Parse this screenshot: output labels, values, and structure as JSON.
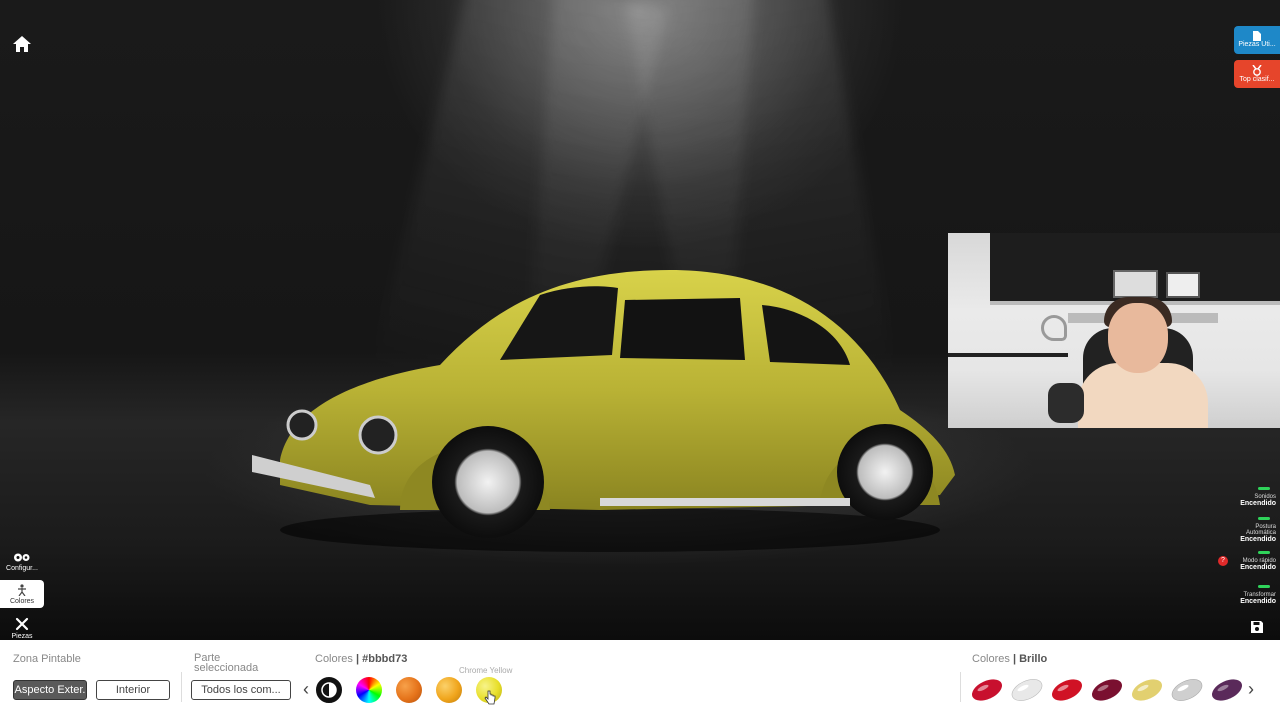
{
  "topright": {
    "parts_label": "Piezas Uti...",
    "parts_color": "#1e88c8",
    "ranking_label": "Top clasif...",
    "ranking_color": "#e6452b"
  },
  "sidebar": {
    "items": [
      {
        "label": "Configur...",
        "icon": "gears-icon"
      },
      {
        "label": "Colores",
        "icon": "paint-figure-icon"
      },
      {
        "label": "Piezas",
        "icon": "tools-icon"
      }
    ]
  },
  "toggles": [
    {
      "label": "Sonidos",
      "value": "Encendido"
    },
    {
      "label": "Postura Automática",
      "value": "Encendido"
    },
    {
      "label": "Modo rápido",
      "value": "Encendido"
    },
    {
      "label": "Transformar",
      "value": "Encendido"
    }
  ],
  "help_badge": "?",
  "bottom": {
    "zone_label": "Zona Pintable",
    "zone_options": [
      "Aspecto Exter.",
      "Interior"
    ],
    "part_label": "Parte seleccionada",
    "part_value": "Todos los com...",
    "colors_label": "Colores",
    "colors_hex": "#bbbd73",
    "hover_tooltip": "Chrome Yellow",
    "swatches": [
      {
        "name": "contrast",
        "color": "#111111"
      },
      {
        "name": "color-wheel",
        "color": "rainbow"
      },
      {
        "name": "orange",
        "color": "#e5731a"
      },
      {
        "name": "amber",
        "color": "#f0a51c"
      },
      {
        "name": "chrome-yellow",
        "color": "#e8df2a"
      }
    ],
    "finish_label": "Colores",
    "finish_value": "Brillo",
    "finish_swatches": [
      "#c8102e",
      "#e8e8e8",
      "#d01225",
      "#7a1030",
      "#e2d070",
      "#cfcfcf",
      "#5a2a5a"
    ]
  },
  "car_color": "#bbbd73"
}
